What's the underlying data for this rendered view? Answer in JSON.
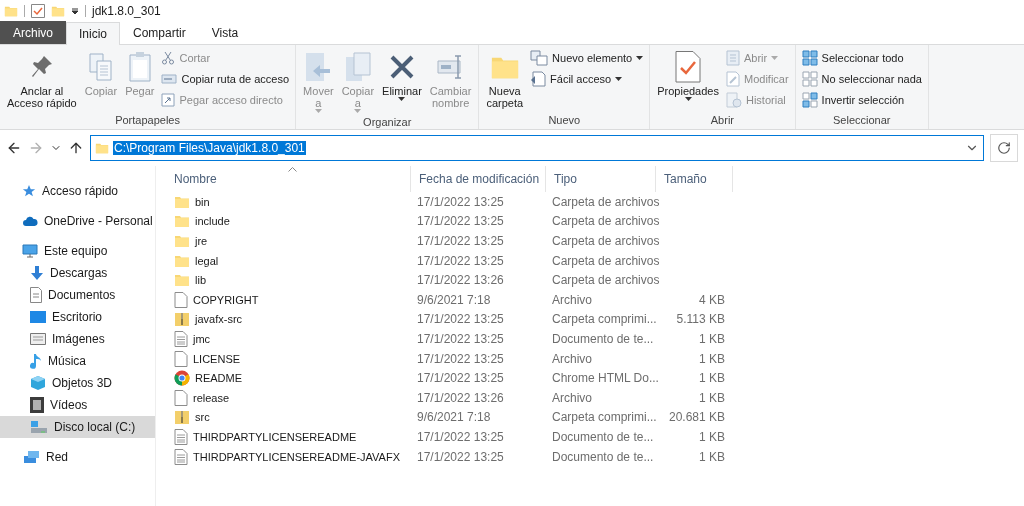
{
  "title_bar": {
    "title": "jdk1.8.0_301"
  },
  "tabs": [
    {
      "label": "Archivo",
      "kind": "file",
      "selected": false
    },
    {
      "label": "Inicio",
      "kind": "tab",
      "selected": true
    },
    {
      "label": "Compartir",
      "kind": "tab",
      "selected": false
    },
    {
      "label": "Vista",
      "kind": "tab",
      "selected": false
    }
  ],
  "ribbon": [
    {
      "label": "Portapapeles",
      "items": [
        {
          "kind": "large",
          "lines": [
            "Anclar al",
            "Acceso rápido"
          ],
          "disabled": false
        },
        {
          "kind": "large",
          "lines": [
            "Copiar"
          ],
          "disabled": true
        },
        {
          "kind": "large",
          "lines": [
            "Pegar"
          ],
          "disabled": true
        },
        {
          "kind": "stack",
          "buttons": [
            {
              "label": "Cortar",
              "disabled": true
            },
            {
              "label": "Copiar ruta de acceso",
              "disabled": false
            },
            {
              "label": "Pegar acceso directo",
              "disabled": true
            }
          ]
        }
      ]
    },
    {
      "label": "Organizar",
      "items": [
        {
          "kind": "large",
          "lines": [
            "Mover",
            "a"
          ],
          "caret": true,
          "disabled": true
        },
        {
          "kind": "large",
          "lines": [
            "Copiar",
            "a"
          ],
          "caret": true,
          "disabled": true
        },
        {
          "kind": "large",
          "lines": [
            "Eliminar"
          ],
          "caret": true,
          "disabled": false
        },
        {
          "kind": "large",
          "lines": [
            "Cambiar",
            "nombre"
          ],
          "disabled": true
        }
      ]
    },
    {
      "label": "Nuevo",
      "items": [
        {
          "kind": "large",
          "lines": [
            "Nueva",
            "carpeta"
          ],
          "disabled": false
        },
        {
          "kind": "stack",
          "buttons": [
            {
              "label": "Nuevo elemento",
              "caret": true,
              "disabled": false
            },
            {
              "label": "Fácil acceso",
              "caret": true,
              "disabled": false
            }
          ]
        }
      ]
    },
    {
      "label": "Abrir",
      "items": [
        {
          "kind": "large",
          "lines": [
            "Propiedades"
          ],
          "caret": true,
          "disabled": false
        },
        {
          "kind": "stack",
          "buttons": [
            {
              "label": "Abrir",
              "caret": true,
              "disabled": true
            },
            {
              "label": "Modificar",
              "disabled": true
            },
            {
              "label": "Historial",
              "disabled": true
            }
          ]
        }
      ]
    },
    {
      "label": "Seleccionar",
      "items": [
        {
          "kind": "stack",
          "buttons": [
            {
              "label": "Seleccionar todo",
              "disabled": false
            },
            {
              "label": "No seleccionar nada",
              "disabled": false
            },
            {
              "label": "Invertir selección",
              "disabled": false
            }
          ]
        }
      ]
    }
  ],
  "address": {
    "value": "C:\\Program Files\\Java\\jdk1.8.0_301",
    "selected": true
  },
  "sidebar": {
    "items": [
      {
        "label": "Acceso rápido",
        "selected": false
      },
      {
        "label": "OneDrive - Personal",
        "selected": false
      },
      {
        "label": "Este equipo",
        "selected": false,
        "children": [
          {
            "label": "Descargas",
            "selected": false
          },
          {
            "label": "Documentos",
            "selected": false
          },
          {
            "label": "Escritorio",
            "selected": false
          },
          {
            "label": "Imágenes",
            "selected": false
          },
          {
            "label": "Música",
            "selected": false
          },
          {
            "label": "Objetos 3D",
            "selected": false
          },
          {
            "label": "Vídeos",
            "selected": false
          },
          {
            "label": "Disco local (C:)",
            "selected": true
          }
        ]
      },
      {
        "label": "Red",
        "selected": false
      }
    ]
  },
  "table": {
    "columns": [
      {
        "label": "Nombre",
        "sorted": true
      },
      {
        "label": "Fecha de modificación",
        "sorted": false
      },
      {
        "label": "Tipo",
        "sorted": false
      },
      {
        "label": "Tamaño",
        "sorted": false
      }
    ],
    "rows": [
      {
        "kind": "folder",
        "name": "bin",
        "date": "17/1/2022 13:25",
        "type": "Carpeta de archivos"
      },
      {
        "kind": "folder",
        "name": "include",
        "date": "17/1/2022 13:25",
        "type": "Carpeta de archivos"
      },
      {
        "kind": "folder",
        "name": "jre",
        "date": "17/1/2022 13:25",
        "type": "Carpeta de archivos"
      },
      {
        "kind": "folder",
        "name": "legal",
        "date": "17/1/2022 13:25",
        "type": "Carpeta de archivos"
      },
      {
        "kind": "folder",
        "name": "lib",
        "date": "17/1/2022 13:26",
        "type": "Carpeta de archivos"
      },
      {
        "kind": "file",
        "name": "COPYRIGHT",
        "date": "9/6/2021 7:18",
        "type": "Archivo",
        "size": "4 KB"
      },
      {
        "kind": "zip",
        "name": "javafx-src",
        "date": "17/1/2022 13:25",
        "type": "Carpeta comprimi...",
        "size": "5.113 KB"
      },
      {
        "kind": "text",
        "name": "jmc",
        "date": "17/1/2022 13:25",
        "type": "Documento de te...",
        "size": "1 KB"
      },
      {
        "kind": "file",
        "name": "LICENSE",
        "date": "17/1/2022 13:25",
        "type": "Archivo",
        "size": "1 KB"
      },
      {
        "kind": "chrome",
        "name": "README",
        "date": "17/1/2022 13:25",
        "type": "Chrome HTML Do...",
        "size": "1 KB"
      },
      {
        "kind": "file",
        "name": "release",
        "date": "17/1/2022 13:26",
        "type": "Archivo",
        "size": "1 KB"
      },
      {
        "kind": "zip",
        "name": "src",
        "date": "9/6/2021 7:18",
        "type": "Carpeta comprimi...",
        "size": "20.681 KB"
      },
      {
        "kind": "text",
        "name": "THIRDPARTYLICENSEREADME",
        "date": "17/1/2022 13:25",
        "type": "Documento de te...",
        "size": "1 KB"
      },
      {
        "kind": "text",
        "name": "THIRDPARTYLICENSEREADME-JAVAFX",
        "date": "17/1/2022 13:25",
        "type": "Documento de te...",
        "size": "1 KB"
      }
    ]
  }
}
